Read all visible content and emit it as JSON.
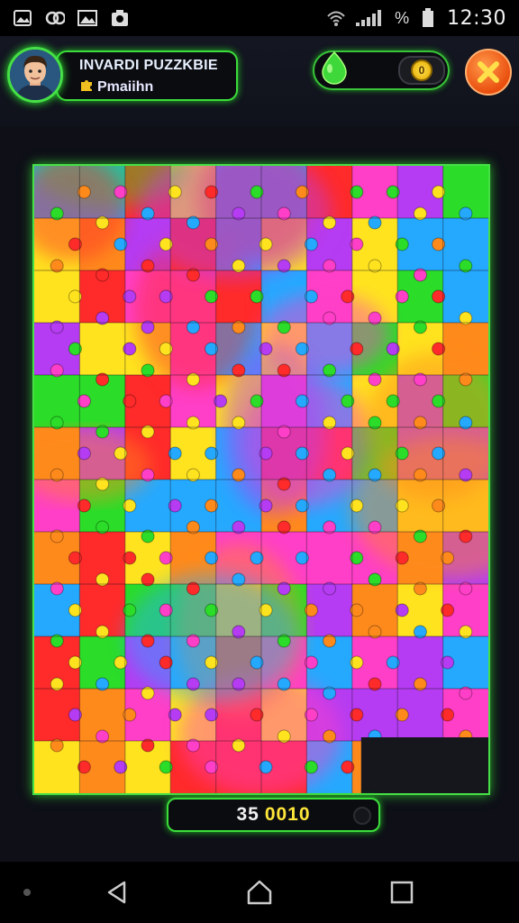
{
  "status_bar": {
    "time": "12:30",
    "battery_percent_label": "%",
    "left_icons": [
      "photo-icon",
      "link-icon",
      "gallery-icon",
      "camera-icon"
    ],
    "right_icons": [
      "wifi-icon",
      "signal-icon",
      "battery-icon"
    ]
  },
  "header": {
    "title": "INVARDI PUZZKBIE",
    "subtitle": "Pmaiihn",
    "coin_label": "0"
  },
  "colors": {
    "accent_green": "#46e046",
    "close_orange": "#ea4f0f",
    "score_yellow": "#ffe63a",
    "puzzle_palette": [
      "#ff2a2a",
      "#ffe31f",
      "#2bdc28",
      "#25a9ff",
      "#b53cf2",
      "#ff8a1c",
      "#ff3fc8"
    ]
  },
  "score": {
    "part_a": "35",
    "part_b": "0010"
  },
  "nav": {
    "buttons": [
      "back-icon",
      "home-icon",
      "recents-icon"
    ]
  }
}
